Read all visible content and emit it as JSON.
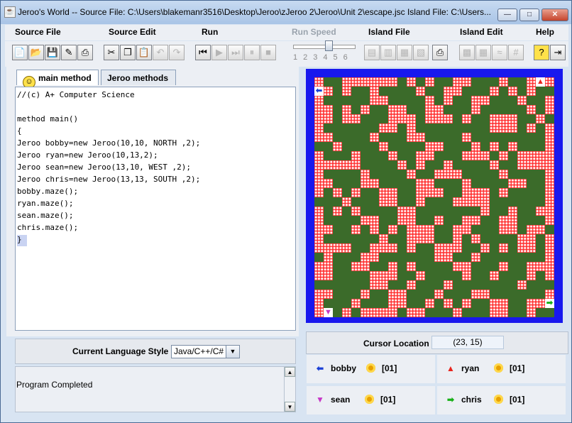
{
  "window": {
    "title": "Jeroo's World -- Source File: C:\\Users\\blakemanr3516\\Desktop\\Jeroo\\zJeroo 2\\Jeroo\\Unit 2\\escape.jsc      Island File: C:\\Users...",
    "minimize": "—",
    "maximize": "□",
    "close": "✕"
  },
  "menu": [
    {
      "label": "Source File",
      "enabled": true
    },
    {
      "label": "Source Edit",
      "enabled": true
    },
    {
      "label": "Run",
      "enabled": true
    },
    {
      "label": "Run Speed",
      "enabled": false
    },
    {
      "label": "Island File",
      "enabled": true
    },
    {
      "label": "Island Edit",
      "enabled": true
    },
    {
      "label": "Help",
      "enabled": true
    }
  ],
  "toolbar": {
    "icons": [
      "new-file-icon",
      "open-file-icon",
      "save-file-icon",
      "save-as-icon",
      "print-icon",
      "cut-icon",
      "copy-icon",
      "paste-icon",
      "undo-icon",
      "redo-icon",
      "reset-icon",
      "run-icon",
      "step-icon",
      "pause-icon",
      "stop-icon",
      "new-island-icon",
      "open-island-icon",
      "save-island-icon",
      "save-island-as-icon",
      "print-island-icon",
      "clear-island-icon",
      "grid-icon",
      "water-icon",
      "net-icon",
      "help-icon",
      "exit-icon"
    ],
    "speed_ticks": [
      "1",
      "2",
      "3",
      "4",
      "5",
      "6"
    ],
    "speed_value": 4
  },
  "tabs": [
    {
      "label": "main method",
      "active": true
    },
    {
      "label": "Jeroo methods",
      "active": false
    }
  ],
  "code": [
    "//(c) A+ Computer Science",
    "",
    "method main()",
    "{",
    "Jeroo bobby=new Jeroo(10,10, NORTH ,2);",
    "Jeroo ryan=new Jeroo(10,13,2);",
    "Jeroo sean=new Jeroo(13,10, WEST ,2);",
    "Jeroo chris=new Jeroo(13,13, SOUTH ,2);",
    "bobby.maze();",
    "ryan.maze();",
    "sean.maze();",
    "chris.maze();",
    "}"
  ],
  "language": {
    "label": "Current Language Style",
    "selected": "Java/C++/C#"
  },
  "output": {
    "text": "Program Completed"
  },
  "cursor": {
    "label": "Cursor Location",
    "value": "(23, 15)"
  },
  "jeroos": [
    {
      "name": "bobby",
      "flowers": "[01]",
      "direction": "west",
      "color": "#1a3fd6"
    },
    {
      "name": "ryan",
      "flowers": "[01]",
      "direction": "north",
      "color": "#e8251e"
    },
    {
      "name": "sean",
      "flowers": "[01]",
      "direction": "south",
      "color": "#c637c6"
    },
    {
      "name": "chris",
      "flowers": "[01]",
      "direction": "east",
      "color": "#18b018"
    }
  ],
  "colors": {
    "water": "#1818ee",
    "grass": "#3b6b2a",
    "flower": "#ff3b3b"
  }
}
